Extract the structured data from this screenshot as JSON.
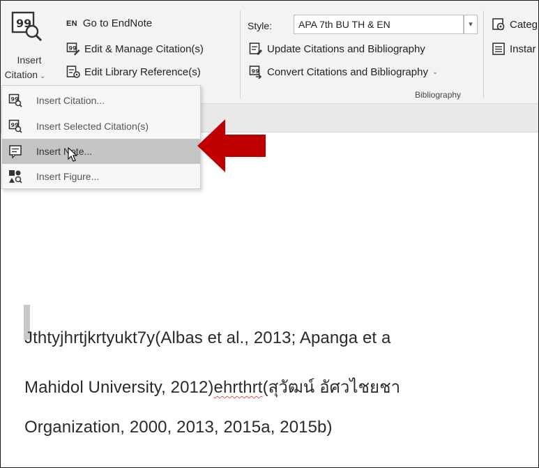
{
  "ribbon": {
    "insert_citation": {
      "line1": "Insert",
      "line2": "Citation",
      "caret": "⌄"
    },
    "go_to_endnote": {
      "badge": "EN",
      "label": "Go to EndNote"
    },
    "edit_manage": "Edit & Manage Citation(s)",
    "edit_library": "Edit Library Reference(s)",
    "style_label": "Style:",
    "style_value": "APA 7th BU TH & EN",
    "update_citations": "Update Citations and Bibliography",
    "convert_citations": "Convert Citations and Bibliography",
    "convert_caret": "⌄",
    "bibliography_group": "Bibliography",
    "categorize": "Categ",
    "instant": "Instar"
  },
  "menu": {
    "items": [
      {
        "label": "Insert Citation...",
        "icon": "insert-citation-icon"
      },
      {
        "label": "Insert Selected Citation(s)",
        "icon": "insert-selected-citation-icon"
      },
      {
        "label": "Insert Note...",
        "icon": "insert-note-icon"
      },
      {
        "label": "Insert Figure...",
        "icon": "insert-figure-icon"
      }
    ],
    "highlighted_index": 2
  },
  "document": {
    "line1": "Jthtyjhrtjkrtyukt7y(Albas et al., 2013; Apanga et a",
    "line2_a": "Mahidol University, 2012)",
    "line2_b": "ehrthrt",
    "line2_c": "(สุวัฒน์ อัศวไชยชา",
    "line3": "Organization, 2000, 2013, 2015a, 2015b)"
  },
  "colors": {
    "arrow": "#c00000",
    "highlight": "#c4c4c4"
  }
}
